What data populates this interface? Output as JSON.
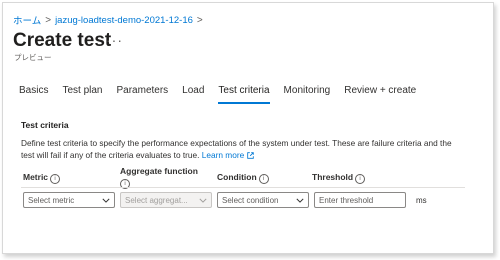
{
  "breadcrumb": {
    "items": [
      "ホーム",
      "jazug-loadtest-demo-2021-12-16"
    ],
    "separator": ">"
  },
  "page": {
    "title": "Create test",
    "more_label": "···",
    "subtitle": "プレビュー"
  },
  "tabs": [
    {
      "label": "Basics",
      "active": false
    },
    {
      "label": "Test plan",
      "active": false
    },
    {
      "label": "Parameters",
      "active": false
    },
    {
      "label": "Load",
      "active": false
    },
    {
      "label": "Test criteria",
      "active": true
    },
    {
      "label": "Monitoring",
      "active": false
    },
    {
      "label": "Review + create",
      "active": false
    }
  ],
  "section": {
    "title": "Test criteria",
    "description": "Define test criteria to specify the performance expectations of the system under test. These are failure criteria and the test will fail if any of the criteria evaluates to true.",
    "learn_more": "Learn more"
  },
  "columns": {
    "metric": "Metric",
    "aggregate": "Aggregate function",
    "condition": "Condition",
    "threshold": "Threshold"
  },
  "row": {
    "metric_placeholder": "Select metric",
    "aggregate_placeholder": "Select aggregat...",
    "condition_placeholder": "Select condition",
    "threshold_placeholder": "Enter threshold",
    "unit": "ms"
  },
  "colors": {
    "accent": "#0078d4",
    "text": "#323130",
    "border": "#8a8886"
  }
}
